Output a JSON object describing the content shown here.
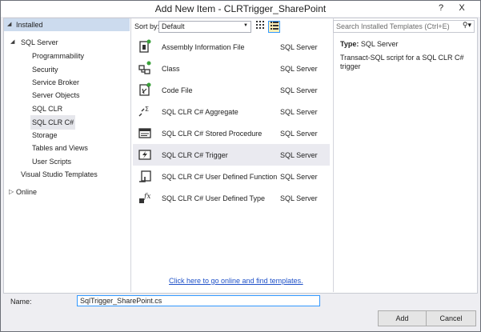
{
  "window": {
    "title": "Add New Item - CLRTrigger_SharePoint",
    "help_label": "?",
    "close_label": "X"
  },
  "sidebar": {
    "installed_label": "Installed",
    "sql_server_label": "SQL Server",
    "items": [
      {
        "label": "Programmability"
      },
      {
        "label": "Security"
      },
      {
        "label": "Service Broker"
      },
      {
        "label": "Server Objects"
      },
      {
        "label": "SQL CLR"
      },
      {
        "label": "SQL CLR C#"
      },
      {
        "label": "Storage"
      },
      {
        "label": "Tables and Views"
      },
      {
        "label": "User Scripts"
      }
    ],
    "vs_templates_label": "Visual Studio Templates",
    "online_label": "Online"
  },
  "toolbar": {
    "sort_label": "Sort by:",
    "sort_value": "Default"
  },
  "templates": [
    {
      "name": "Assembly Information File",
      "type": "SQL Server",
      "icon": "assembly-file-icon"
    },
    {
      "name": "Class",
      "type": "SQL Server",
      "icon": "class-icon"
    },
    {
      "name": "Code File",
      "type": "SQL Server",
      "icon": "code-file-icon"
    },
    {
      "name": "SQL CLR C# Aggregate",
      "type": "SQL Server",
      "icon": "aggregate-icon"
    },
    {
      "name": "SQL CLR C# Stored Procedure",
      "type": "SQL Server",
      "icon": "stored-procedure-icon"
    },
    {
      "name": "SQL CLR C# Trigger",
      "type": "SQL Server",
      "icon": "trigger-icon"
    },
    {
      "name": "SQL CLR C# User Defined Function",
      "type": "SQL Server",
      "icon": "user-defined-function-icon"
    },
    {
      "name": "SQL CLR C# User Defined Type",
      "type": "SQL Server",
      "icon": "user-defined-type-icon"
    }
  ],
  "online_link": "Click here to go online and find templates.",
  "search": {
    "placeholder": "Search Installed Templates (Ctrl+E)"
  },
  "details": {
    "type_label": "Type:",
    "type_value": "SQL Server",
    "description": "Transact-SQL script for a SQL CLR C# trigger"
  },
  "footer": {
    "name_label": "Name:",
    "name_value": "SqlTrigger_SharePoint.cs",
    "add_label": "Add",
    "cancel_label": "Cancel"
  },
  "colors": {
    "selection": "#ccdbee",
    "accent_green": "#3aa03a",
    "link": "#1e50c8"
  }
}
